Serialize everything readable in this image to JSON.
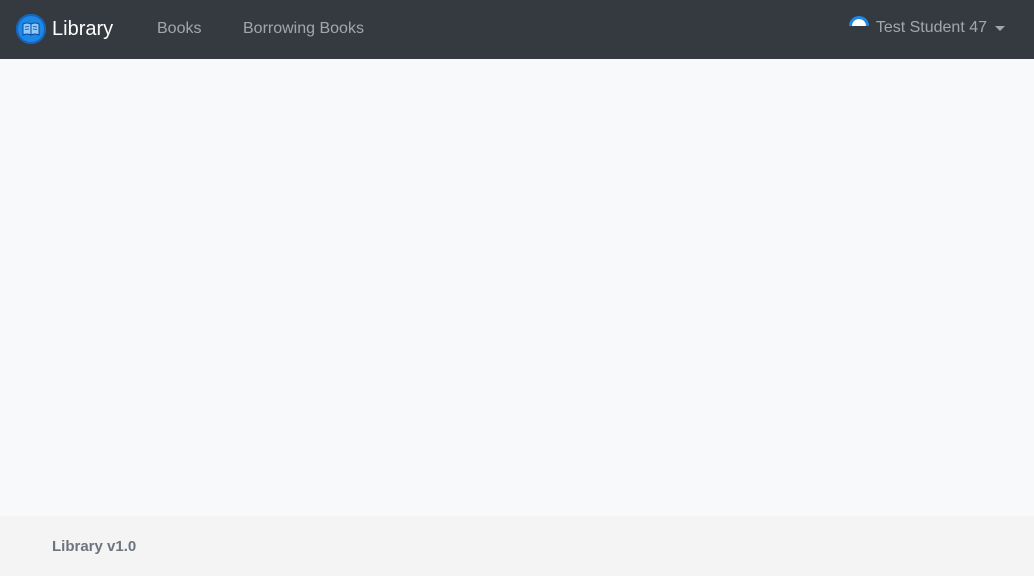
{
  "navbar": {
    "brand": {
      "label": "Library",
      "icon": "book-icon"
    },
    "links": [
      {
        "label": "Books"
      },
      {
        "label": "Borrowing Books"
      }
    ],
    "user": {
      "name": "Test Student 47",
      "avatar_icon": "user-avatar-icon",
      "dropdown_icon": "caret-down-icon"
    }
  },
  "footer": {
    "text": "Library v1.0"
  },
  "colors": {
    "navbar_bg": "#343a40",
    "page_bg": "#f8f9fa",
    "footer_bg": "#f4f4f4",
    "brand_logo": "#1e88e5"
  }
}
